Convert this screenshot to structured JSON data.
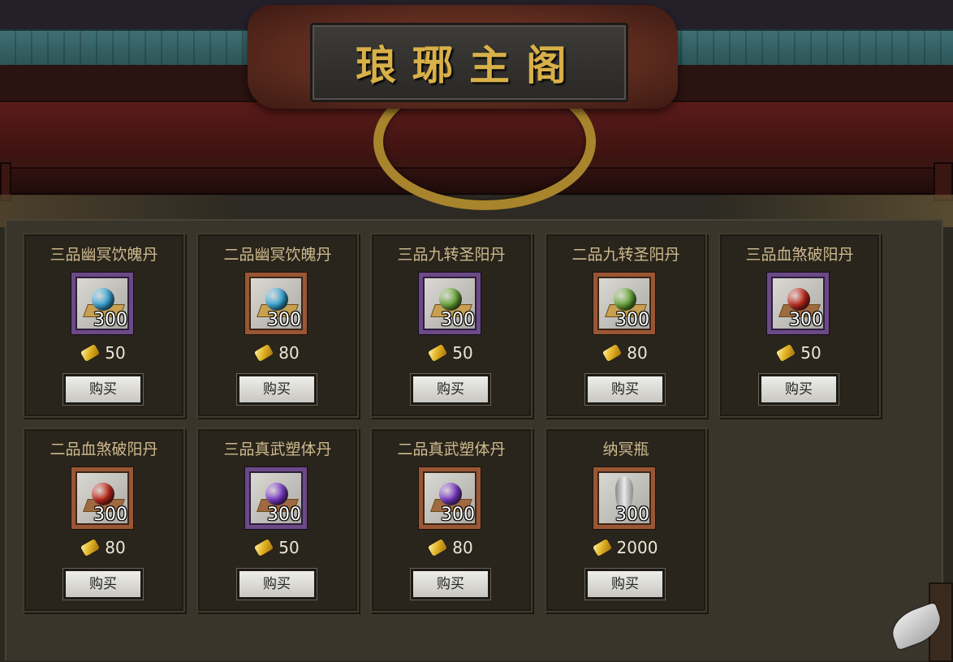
{
  "header": {
    "title": "琅琊主阁"
  },
  "shop": {
    "currency_icon": "gold-ingot-icon",
    "buy_label": "购买",
    "items": [
      {
        "name": "三品幽冥饮魄丹",
        "quantity": "300",
        "price": "50",
        "quality": "purple",
        "gem_color": "#39a8d8",
        "tray": "gold"
      },
      {
        "name": "二品幽冥饮魄丹",
        "quantity": "300",
        "price": "80",
        "quality": "orange",
        "gem_color": "#39a8d8",
        "tray": "gold"
      },
      {
        "name": "三品九转圣阳丹",
        "quantity": "300",
        "price": "50",
        "quality": "purple",
        "gem_color": "#6aa83a",
        "tray": "gold"
      },
      {
        "name": "二品九转圣阳丹",
        "quantity": "300",
        "price": "80",
        "quality": "orange",
        "gem_color": "#6aa83a",
        "tray": "gold"
      },
      {
        "name": "三品血煞破阳丹",
        "quantity": "300",
        "price": "50",
        "quality": "purple",
        "gem_color": "#c0281c",
        "tray": "brown"
      },
      {
        "name": "二品血煞破阳丹",
        "quantity": "300",
        "price": "80",
        "quality": "orange",
        "gem_color": "#c0281c",
        "tray": "brown"
      },
      {
        "name": "三品真武塑体丹",
        "quantity": "300",
        "price": "50",
        "quality": "purple",
        "gem_color": "#7a3ac8",
        "tray": "brown"
      },
      {
        "name": "二品真武塑体丹",
        "quantity": "300",
        "price": "80",
        "quality": "orange",
        "gem_color": "#7a3ac8",
        "tray": "brown"
      },
      {
        "name": "纳冥瓶",
        "quantity": "300",
        "price": "2000",
        "quality": "orange",
        "gem_color": "",
        "tray": "none"
      }
    ]
  }
}
